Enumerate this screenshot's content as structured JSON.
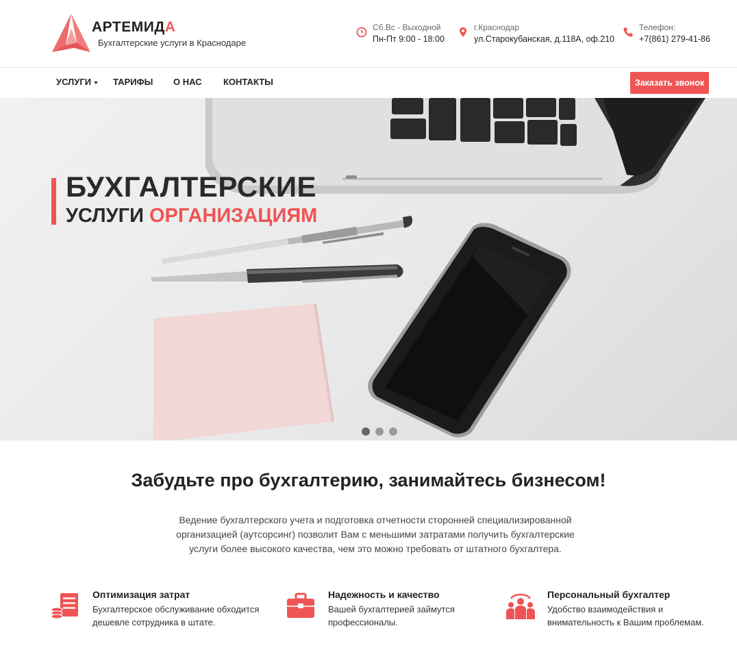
{
  "brand": {
    "name_main": "АРТЕМИД",
    "name_accent": "А",
    "tagline": "Бухгалтерские услуги в Краснодаре",
    "accent_color": "#ef5454"
  },
  "header_info": [
    {
      "icon": "clock-icon",
      "line1": "Сб.Вс - Выходной",
      "line2": "Пн-Пт 9:00 - 18:00"
    },
    {
      "icon": "map-pin-icon",
      "line1": "г.Краснодар",
      "line2": "ул.Старокубанская, д.118А, оф.210"
    },
    {
      "icon": "phone-icon",
      "line1": "Телефон:",
      "line2": "+7(861) 279-41-86"
    }
  ],
  "nav": {
    "items": [
      "УСЛУГИ",
      "ТАРИФЫ",
      "О НАС",
      "КОНТАКТЫ"
    ],
    "cta_label": "Заказать звонок"
  },
  "hero": {
    "line1": "БУХГАЛТЕРСКИЕ",
    "line2_a": "УСЛУГИ",
    "line2_b": "ОРГАНИЗАЦИЯМ",
    "slides_total": 3,
    "active_slide": 1
  },
  "intro": {
    "title": "Забудьте про бухгалтерию, занимайтесь бизнесом!",
    "text": "Ведение бухгалтерского учета и подготовка отчетности сторонней специализированной организацией (аутсорсинг) позволит Вам с меньшими затратами получить бухгалтерские услуги более высокого качества, чем это можно требовать от штатного бухгалтера."
  },
  "features": [
    {
      "icon": "server-coins-icon",
      "title": "Оптимизация затрат",
      "desc": "Бухгалтерское обслуживание обходится дешевле сотрудника в штате."
    },
    {
      "icon": "briefcase-icon",
      "title": "Надежность и качество",
      "desc": "Вашей бухгалтерией займутся профессионалы."
    },
    {
      "icon": "team-icon",
      "title": "Персональный бухгалтер",
      "desc": "Удобство взаимодействия и внимательность к Вашим проблемам."
    }
  ]
}
